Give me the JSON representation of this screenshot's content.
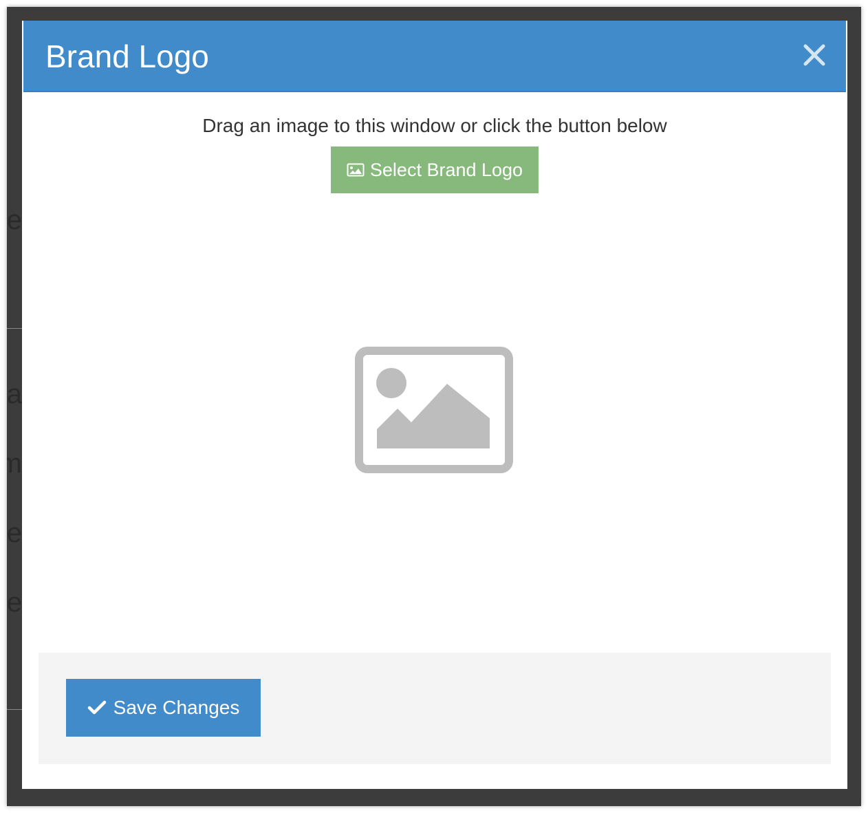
{
  "modal": {
    "title": "Brand Logo",
    "close_icon": "close-icon"
  },
  "body": {
    "instruction": "Drag an image to this window or click the button below",
    "select_button_label": "Select Brand Logo",
    "select_button_icon": "picture-icon",
    "placeholder_icon": "image-placeholder-icon"
  },
  "footer": {
    "save_button_label": "Save Changes",
    "save_button_icon": "checkmark-icon"
  },
  "background_fragments": [
    "e",
    "a",
    "m",
    "e",
    "e"
  ],
  "colors": {
    "header": "#418bca",
    "select_button": "#86b97b",
    "save_button": "#418bca",
    "footer_bg": "#f4f4f4",
    "placeholder_gray": "#bdbdbd"
  }
}
